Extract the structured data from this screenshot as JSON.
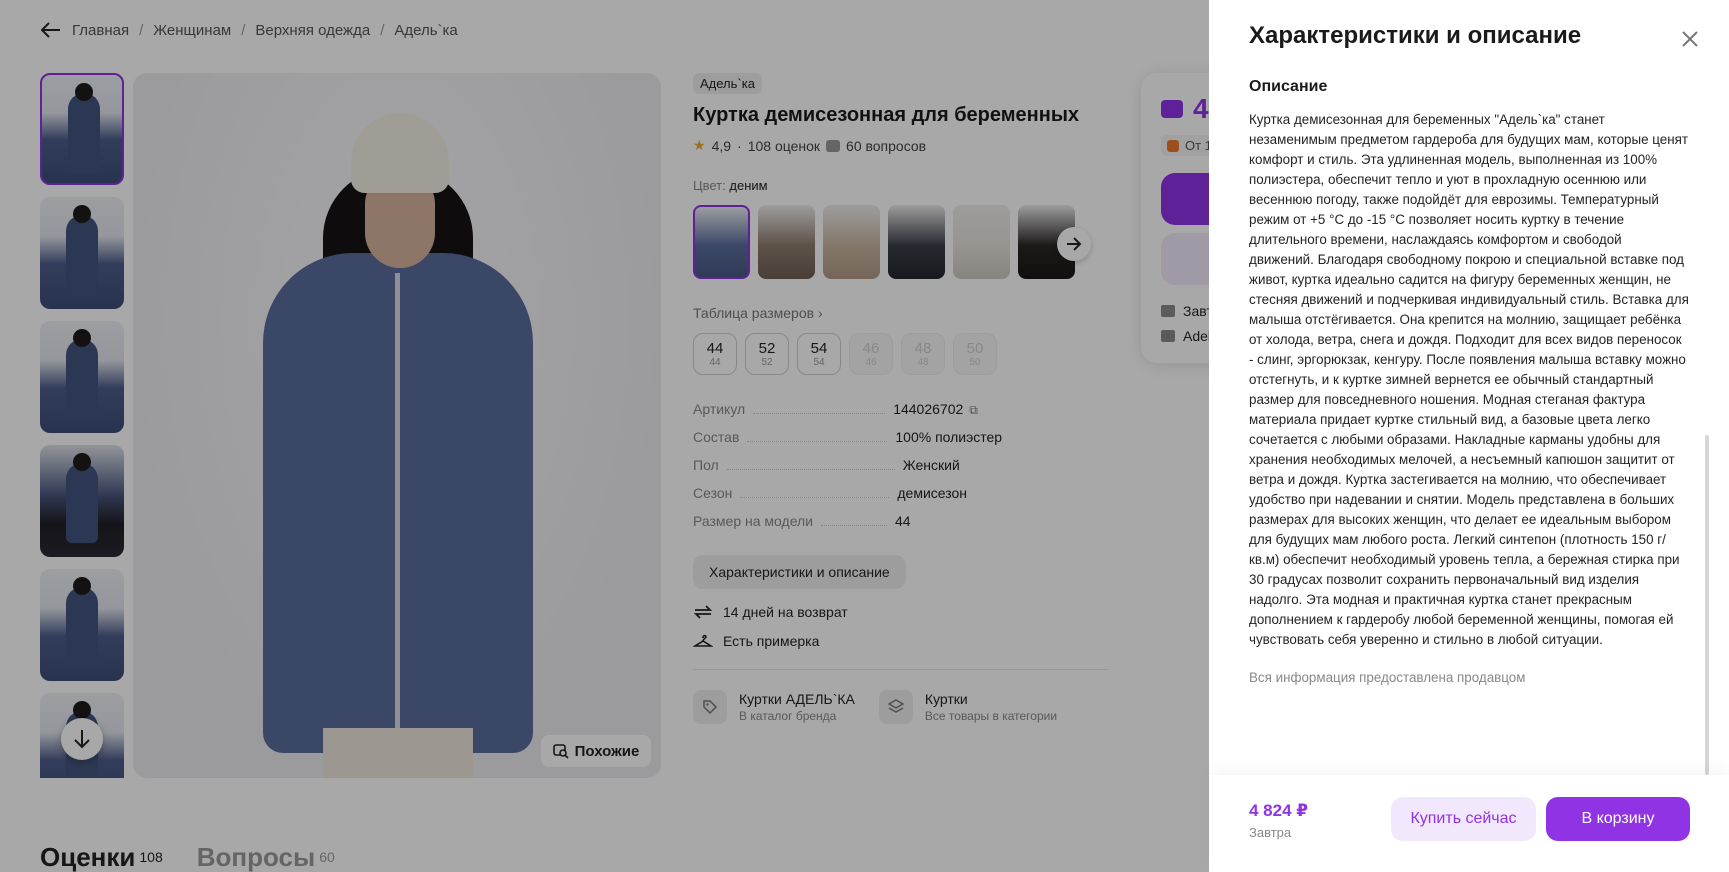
{
  "breadcrumbs": [
    "Главная",
    "Женщинам",
    "Верхняя одежда",
    "Адель`ка"
  ],
  "similar_label": "Похожие",
  "product": {
    "brand": "Адель`ка",
    "title": "Куртка демисезонная для беременных",
    "rating": "4,9",
    "reviews": "108 оценок",
    "questions": "60 вопросов",
    "color_label": "Цвет:",
    "color_value": "деним",
    "size_table": "Таблица размеров",
    "sizes": [
      {
        "big": "44",
        "small": "44"
      },
      {
        "big": "52",
        "small": "52"
      },
      {
        "big": "54",
        "small": "54"
      },
      {
        "big": "46",
        "small": "46"
      },
      {
        "big": "48",
        "small": "48"
      },
      {
        "big": "50",
        "small": "50"
      }
    ],
    "specs": [
      {
        "k": "Артикул",
        "v": "144026702"
      },
      {
        "k": "Состав",
        "v": "100% полиэстер"
      },
      {
        "k": "Пол",
        "v": "Женский"
      },
      {
        "k": "Сезон",
        "v": "демисезон"
      },
      {
        "k": "Размер на модели",
        "v": "44"
      }
    ],
    "char_button": "Характеристики и описание",
    "perks": [
      "14 дней на возврат",
      "Есть примерка"
    ],
    "links": [
      {
        "title": "Куртки АДЕЛЬ`КА",
        "sub": "В каталог бренда"
      },
      {
        "title": "Куртки",
        "sub": "Все товары в категории"
      }
    ]
  },
  "buybox": {
    "price_partial": "4",
    "badge_partial": "От 1",
    "delivery_partial": "Завт",
    "seller_partial": "Adel"
  },
  "tabs": {
    "reviews_title": "Оценки",
    "reviews_count": "108",
    "questions_title": "Вопросы",
    "questions_count": "60"
  },
  "panel": {
    "title": "Характеристики и описание",
    "section_title": "Описание",
    "description": "Куртка демисезонная для беременных \"Адель`ка\" станет незаменимым предметом гардероба для будущих мам, которые ценят комфорт и стиль. Эта удлиненная модель, выполненная из 100% полиэстера, обеспечит тепло и уют в прохладную осеннюю или весеннюю погоду, также подойдёт для еврозимы. Температурный режим от +5 °C до -15 °C позволяет носить куртку в течение длительного времени, наслаждаясь комфортом и свободой движений. Благодаря свободному покрою и специальной вставке под живот, куртка идеально садится на фигуру беременных женщин, не стесняя движений и подчеркивая индивидуальный стиль. Вставка для малыша отстёгивается. Она крепится на молнию, защищает ребёнка от холода, ветра, снега и дождя. Подходит для всех видов переносок - слинг, эргорюкзак, кенгуру. После появления малыша вставку можно отстегнуть, и к куртке зимней вернется ее обычный стандартный размер для повседневного ношения. Модная стеганая фактура материала придает куртке стильный вид, а базовые цвета легко сочетается с любыми образами. Накладные карманы удобны для хранения необходимых мелочей, а несъемный капюшон защитит от ветра и дождя. Куртка застегивается на молнию, что обеспечивает удобство при надевании и снятии. Модель представлена в больших размерах для высоких женщин, что делает ее идеальным выбором для будущих мам любого роста. Легкий синтепон (плотность 150 г/кв.м) обеспечит необходимый уровень тепла, а бережная стирка при 30 градусах позволит сохранить первоначальный вид изделия надолго. Эта модная и практичная куртка станет прекрасным дополнением к гардеробу любой беременной женщины, помогая ей чувствовать себя уверенно и стильно в любой ситуации.",
    "disclaimer": "Вся информация предоставлена продавцом",
    "footer_price": "4 824 ₽",
    "footer_when": "Завтра",
    "buy_now": "Купить сейчас",
    "to_cart": "В корзину"
  },
  "colors": {
    "accent": "#8f33e5",
    "accent_light": "#f1e8fd",
    "overlay": "rgba(0,0,0,0.34)"
  }
}
